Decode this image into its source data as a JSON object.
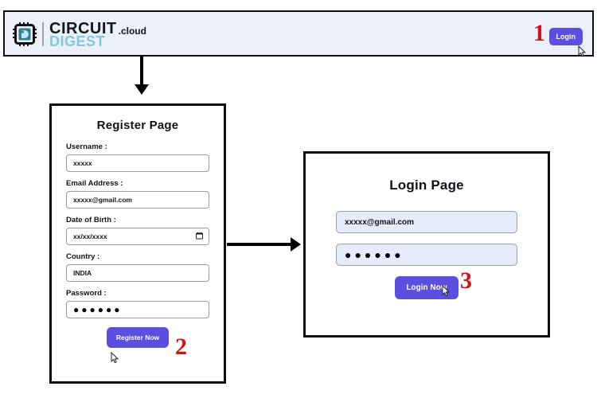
{
  "header": {
    "brand": {
      "icon": "microchip-icon",
      "line1": "CIRCUIT",
      "line2": "DIGEST",
      "suffix": ".cloud"
    },
    "login_button_label": "Login"
  },
  "annotations": {
    "step1": "1",
    "step2": "2",
    "step3": "3"
  },
  "register_card": {
    "title": "Register Page",
    "fields": [
      {
        "label": "Username :",
        "value": "xxxxx",
        "type": "text"
      },
      {
        "label": "Email Address :",
        "value": "xxxxx@gmail.com",
        "type": "email"
      },
      {
        "label": "Date of Birth :",
        "value": "xx/xx/xxxx",
        "type": "date"
      },
      {
        "label": "Country :",
        "value": "INDIA",
        "type": "text"
      },
      {
        "label": "Password :",
        "value": "●●●●●●",
        "type": "password"
      }
    ],
    "submit_label": "Register Now"
  },
  "login_card": {
    "title": "Login Page",
    "fields": [
      {
        "value": "xxxxx@gmail.com",
        "type": "email"
      },
      {
        "value": "●●●●●●",
        "type": "password"
      }
    ],
    "submit_label": "Login Now"
  },
  "colors": {
    "accent_purple": "#5b4ee0",
    "annotation_red": "#d51119",
    "header_bg": "#edf0f9",
    "login_input_bg": "#e7ecfa",
    "brand_digest": "#7fc9e0"
  }
}
